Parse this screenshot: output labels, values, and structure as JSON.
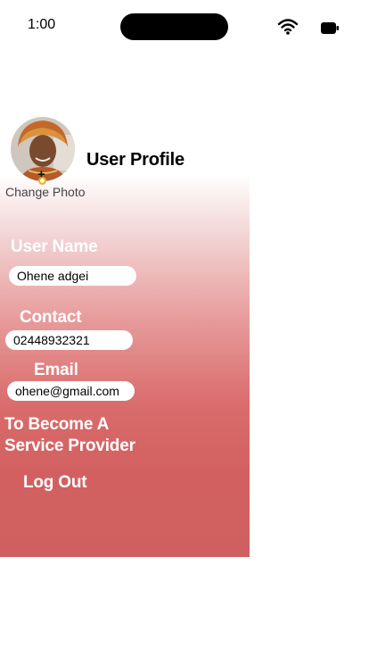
{
  "status_bar": {
    "time": "1:00"
  },
  "header": {
    "title": "User Profile",
    "change_photo": "Change Photo",
    "plus_glyph": "+"
  },
  "form": {
    "user_name": {
      "label": "User Name",
      "value": "Ohene adgei"
    },
    "contact": {
      "label": "Contact",
      "value": "02448932321"
    },
    "email": {
      "label": "Email",
      "value": "ohene@gmail.com"
    }
  },
  "actions": {
    "become_provider_line1": "To  Become  A",
    "become_provider_line2": "Service Provider",
    "logout": "Log Out"
  },
  "colors": {
    "panel_top": "#ffffff",
    "panel_bottom": "#d05f5f",
    "label_text": "#ffffff",
    "field_bg": "#ffffff"
  }
}
